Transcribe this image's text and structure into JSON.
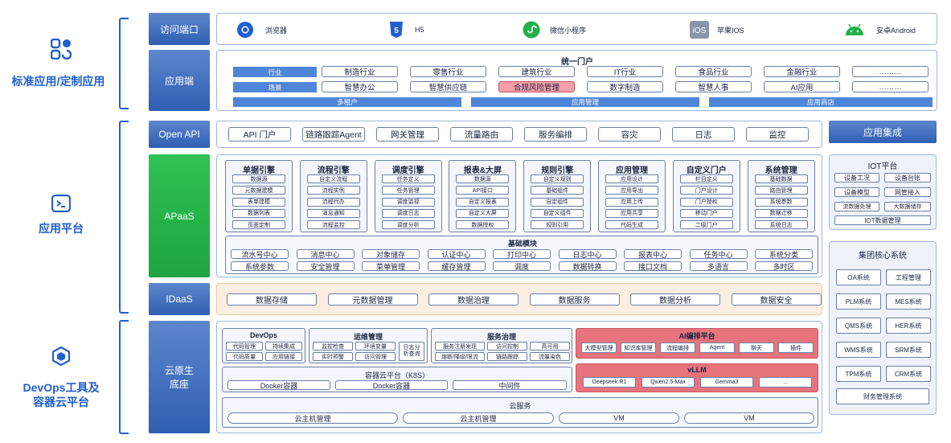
{
  "sides": {
    "standard": "标准应用/定制应用",
    "platform": "应用平台",
    "devops1": "DevOps工具及",
    "devops2": "容器云平台"
  },
  "rows": {
    "access": "访问端口",
    "app": "应用端",
    "openapi": "Open API",
    "apaas": "APaaS",
    "idaas": "IDaaS",
    "cloud1": "云原生",
    "cloud2": "底座"
  },
  "access": [
    {
      "label": "浏览器",
      "icon": "chrome-icon"
    },
    {
      "label": "H5",
      "icon": "html5-icon"
    },
    {
      "label": "微信小程序",
      "icon": "wechat-miniprogram-icon"
    },
    {
      "label": "苹果IOS",
      "icon": "ios-icon"
    },
    {
      "label": "安卓Android",
      "icon": "android-icon"
    }
  ],
  "app": {
    "title": "统一门户",
    "industry_label": "行业",
    "scene_label": "场景",
    "industry": [
      "制造行业",
      "零售行业",
      "建筑行业",
      "IT行业",
      "食品行业",
      "金融行业",
      "………"
    ],
    "scene": [
      "智慧办公",
      "智慧供应链",
      "合规风险管理",
      "数字制造",
      "智慧人事",
      "AI应用",
      "………"
    ],
    "bars": [
      "多租户",
      "应用管理",
      "应用商店"
    ]
  },
  "openapi": [
    "API 门户",
    "链路跟踪Agent",
    "网关管理",
    "流量路由",
    "服务编排",
    "容灾",
    "日志",
    "监控"
  ],
  "apaas": {
    "engines": [
      {
        "title": "单据引擎",
        "items": [
          "数据源",
          "元数据建模",
          "表单建模",
          "数据列表",
          "页面定制"
        ]
      },
      {
        "title": "流程引擎",
        "items": [
          "自定义流程",
          "流程实例",
          "流程代办",
          "消息通知",
          "流程监控"
        ]
      },
      {
        "title": "调度引擎",
        "items": [
          "任务定义",
          "任务管理",
          "调度监视",
          "调度日志",
          "调度分析"
        ]
      },
      {
        "title": "报表&大屏",
        "items": [
          "数据源",
          "API接口",
          "自定义报表",
          "自定义大屏",
          "数据授权"
        ]
      },
      {
        "title": "规则引擎",
        "items": [
          "自定义规则",
          "基础组件",
          "自定组件",
          "自定义组件",
          "规则引用"
        ]
      },
      {
        "title": "应用管理",
        "items": [
          "应用设计",
          "应用导出",
          "应用上传",
          "应用共享",
          "代码生成"
        ]
      },
      {
        "title": "自定义门户",
        "items": [
          "栏目定义",
          "门户设计",
          "门户授权",
          "移动门户",
          "二级门户"
        ]
      },
      {
        "title": "系统管理",
        "items": [
          "基础数据",
          "路由管理",
          "系统参数",
          "数据迁移",
          "系统日志"
        ]
      }
    ],
    "base_title": "基础模块",
    "base_row1": [
      "流水号中心",
      "消息中心",
      "对象储存",
      "认证中心",
      "打印中心",
      "日志中心",
      "报表中心",
      "任务中心",
      "系统分类"
    ],
    "base_row2": [
      "系统参数",
      "安全管理",
      "菜单管理",
      "缓存管理",
      "调度",
      "数据转换",
      "接口文档",
      "多语言",
      "多时区"
    ]
  },
  "idaas": [
    "数据存储",
    "元数据管理",
    "数据治理",
    "数据服务",
    "数据分析",
    "数据安全"
  ],
  "cloud": {
    "devops_title": "DevOps",
    "devops": [
      "代码管理",
      "持续集成",
      "代码质量",
      "应用链接"
    ],
    "ops_title": "运维管理",
    "ops": [
      "监控检查",
      "环境变量",
      "实时预警",
      "访问管理"
    ],
    "ops_log": "日志分析查询",
    "svc_title": "服务治理",
    "svc": [
      "服务注册发现",
      "访问控制",
      "高可用",
      "熔断/降级/限流",
      "链路跟踪",
      "流量染色"
    ],
    "ai_title": "AI编排平台",
    "ai": [
      "大模型管理",
      "知识库管理",
      "流程编排",
      "Agent",
      "聊天",
      "插件"
    ],
    "vllm_title": "vLLM",
    "vllm": [
      "Deepseek R1",
      "Qwen2.5-Max",
      "Gemma3",
      "..."
    ],
    "k8s_title": "容器云平台（K8S）",
    "k8s": [
      "Docker容器",
      "Docker容器",
      "中间件"
    ],
    "cloud_title": "云服务",
    "cloud": [
      "云主机管理",
      "云主机管理",
      "VM",
      "VM"
    ]
  },
  "right": {
    "integration": "应用集成",
    "iot_title": "IOT平台",
    "iot": [
      "设备工况",
      "设备台账",
      "设备模型",
      "网管接入",
      "流数据处理",
      "大数据储存"
    ],
    "iot_data": "IOT数据管理",
    "core_title": "集团核心系统",
    "core": [
      "OA系统",
      "工程管理",
      "PLM系统",
      "MES系统",
      "QMS系统",
      "HER系统",
      "WMS系统",
      "SRM系统",
      "TPM系统",
      "CRM系统"
    ],
    "core_last": "财务管理系统"
  },
  "colors": {
    "accent": "#1f5fd0",
    "rowlab": "#3d6cbf",
    "green": "#22b14c",
    "pink": "#f3a0a8",
    "ai_bg": "#e7747c"
  }
}
